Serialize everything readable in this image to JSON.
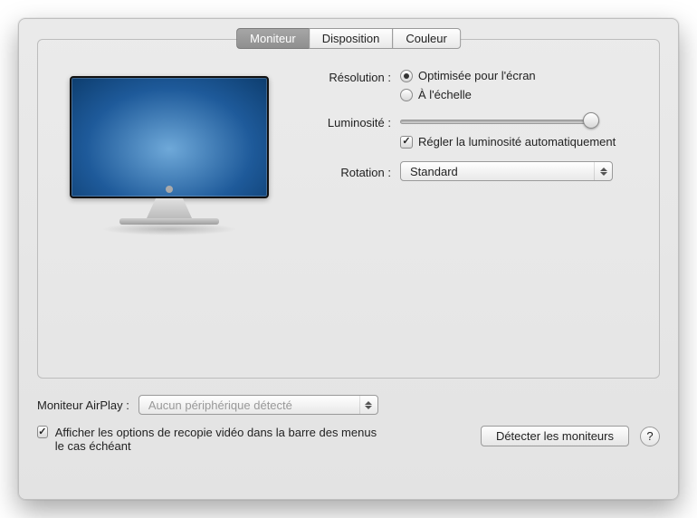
{
  "tabs": {
    "monitor": "Moniteur",
    "layout": "Disposition",
    "color": "Couleur"
  },
  "settings": {
    "resolution_label": "Résolution :",
    "resolution_opt_best": "Optimisée pour l'écran",
    "resolution_opt_scaled": "À l'échelle",
    "brightness_label": "Luminosité :",
    "brightness_auto": "Régler la luminosité automatiquement",
    "rotation_label": "Rotation :",
    "rotation_value": "Standard"
  },
  "airplay": {
    "label": "Moniteur AirPlay :",
    "value": "Aucun périphérique détecté"
  },
  "footer": {
    "mirror_option": "Afficher les options de recopie vidéo dans la barre des menus le cas échéant",
    "detect_button": "Détecter les moniteurs",
    "help": "?"
  }
}
